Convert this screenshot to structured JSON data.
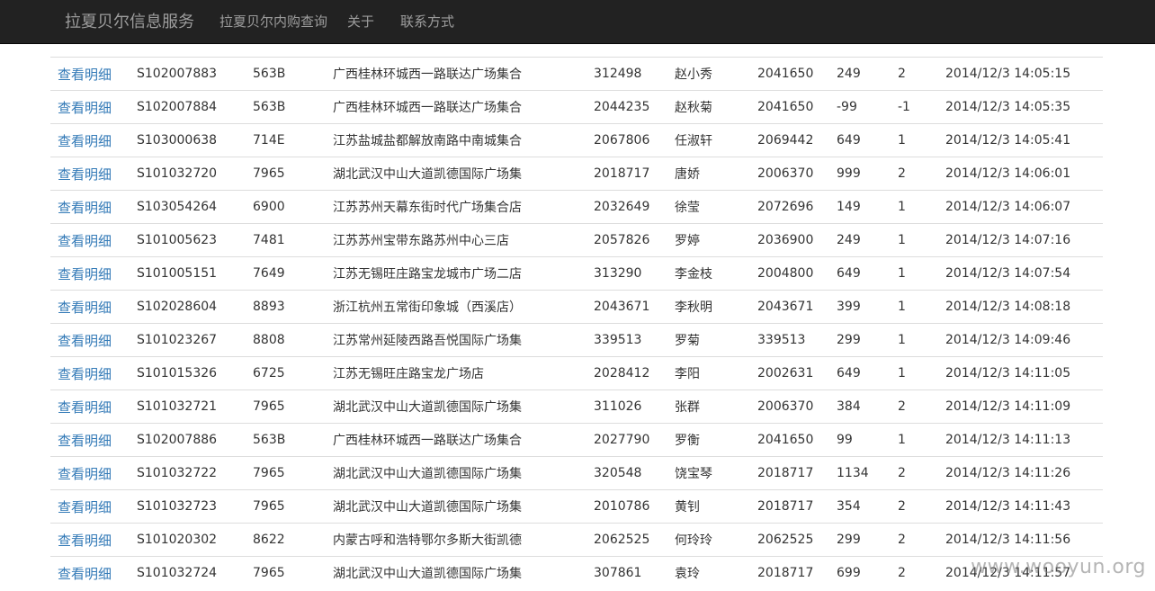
{
  "navbar": {
    "brand": "拉夏贝尔信息服务",
    "links": [
      "拉夏贝尔内购查询",
      "关于",
      "联系方式"
    ]
  },
  "table": {
    "link_label": "查看明细",
    "rows": [
      [
        "S102007883",
        "563B",
        "广西桂林环城西一路联达广场集合",
        "312498",
        "赵小秀",
        "2041650",
        "249",
        "2",
        "2014/12/3 14:05:15"
      ],
      [
        "S102007884",
        "563B",
        "广西桂林环城西一路联达广场集合",
        "2044235",
        "赵秋菊",
        "2041650",
        "-99",
        "-1",
        "2014/12/3 14:05:35"
      ],
      [
        "S103000638",
        "714E",
        "江苏盐城盐都解放南路中南城集合",
        "2067806",
        "任淑轩",
        "2069442",
        "649",
        "1",
        "2014/12/3 14:05:41"
      ],
      [
        "S101032720",
        "7965",
        "湖北武汉中山大道凯德国际广场集",
        "2018717",
        "唐娇",
        "2006370",
        "999",
        "2",
        "2014/12/3 14:06:01"
      ],
      [
        "S103054264",
        "6900",
        "江苏苏州天幕东街时代广场集合店",
        "2032649",
        "徐莹",
        "2072696",
        "149",
        "1",
        "2014/12/3 14:06:07"
      ],
      [
        "S101005623",
        "7481",
        "江苏苏州宝带东路苏州中心三店",
        "2057826",
        "罗婷",
        "2036900",
        "249",
        "1",
        "2014/12/3 14:07:16"
      ],
      [
        "S101005151",
        "7649",
        "江苏无锡旺庄路宝龙城市广场二店",
        "313290",
        "李金枝",
        "2004800",
        "649",
        "1",
        "2014/12/3 14:07:54"
      ],
      [
        "S102028604",
        "8893",
        "浙江杭州五常街印象城（西溪店）",
        "2043671",
        "李秋明",
        "2043671",
        "399",
        "1",
        "2014/12/3 14:08:18"
      ],
      [
        "S101023267",
        "8808",
        "江苏常州延陵西路吾悦国际广场集",
        "339513",
        "罗菊",
        "339513",
        "299",
        "1",
        "2014/12/3 14:09:46"
      ],
      [
        "S101015326",
        "6725",
        "江苏无锡旺庄路宝龙广场店",
        "2028412",
        "李阳",
        "2002631",
        "649",
        "1",
        "2014/12/3 14:11:05"
      ],
      [
        "S101032721",
        "7965",
        "湖北武汉中山大道凯德国际广场集",
        "311026",
        "张群",
        "2006370",
        "384",
        "2",
        "2014/12/3 14:11:09"
      ],
      [
        "S102007886",
        "563B",
        "广西桂林环城西一路联达广场集合",
        "2027790",
        "罗衡",
        "2041650",
        "99",
        "1",
        "2014/12/3 14:11:13"
      ],
      [
        "S101032722",
        "7965",
        "湖北武汉中山大道凯德国际广场集",
        "320548",
        "饶宝琴",
        "2018717",
        "1134",
        "2",
        "2014/12/3 14:11:26"
      ],
      [
        "S101032723",
        "7965",
        "湖北武汉中山大道凯德国际广场集",
        "2010786",
        "黄钊",
        "2018717",
        "354",
        "2",
        "2014/12/3 14:11:43"
      ],
      [
        "S101020302",
        "8622",
        "内蒙古呼和浩特鄂尔多斯大街凯德",
        "2062525",
        "何玲玲",
        "2062525",
        "299",
        "2",
        "2014/12/3 14:11:56"
      ],
      [
        "S101032724",
        "7965",
        "湖北武汉中山大道凯德国际广场集",
        "307861",
        "袁玲",
        "2018717",
        "699",
        "2",
        "2014/12/3 14:11:57"
      ]
    ]
  },
  "watermark": "www.wooyun.org"
}
